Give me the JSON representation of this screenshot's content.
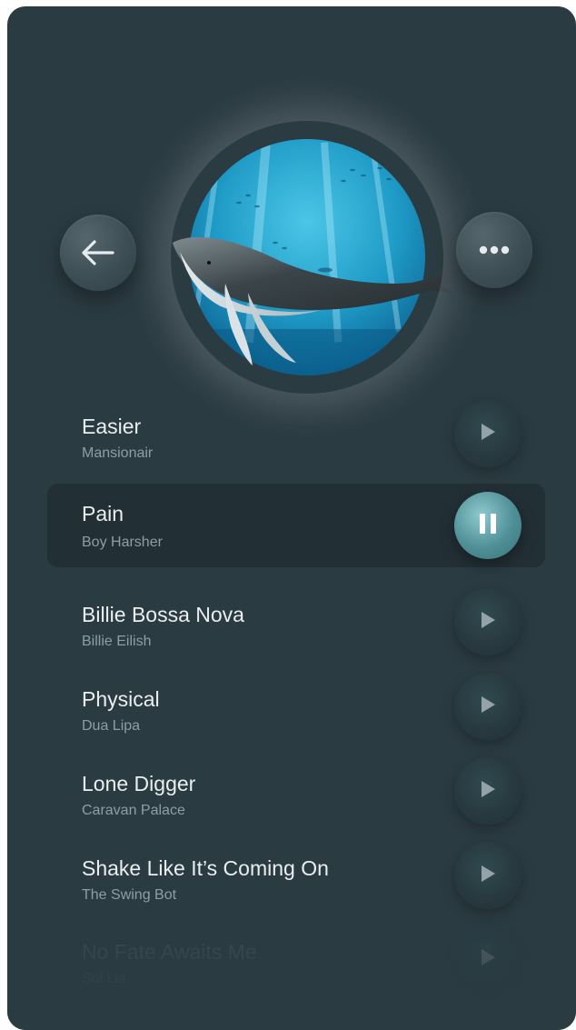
{
  "header": {
    "back_icon": "arrow-left-icon",
    "more_icon": "ellipsis-icon",
    "album_art": "whale-underwater-artwork"
  },
  "colors": {
    "background": "#2b3b42",
    "active_row": "#222f35",
    "accent": "#5fa3aa",
    "title_text": "#e9eef0",
    "subtitle_text": "#8f9ea4"
  },
  "tracks": [
    {
      "title": "Easier",
      "artist": "Mansionair",
      "state": "play"
    },
    {
      "title": "Pain",
      "artist": "Boy Harsher",
      "state": "pause"
    },
    {
      "title": "Billie Bossa Nova",
      "artist": "Billie Eilish",
      "state": "play"
    },
    {
      "title": "Physical",
      "artist": "Dua Lipa",
      "state": "play"
    },
    {
      "title": "Lone Digger",
      "artist": "Caravan Palace",
      "state": "play"
    },
    {
      "title": "Shake Like It’s Coming On",
      "artist": "The Swing Bot",
      "state": "play"
    },
    {
      "title": "No Fate Awaits Me",
      "artist": "Sol Lia",
      "state": "play"
    }
  ]
}
